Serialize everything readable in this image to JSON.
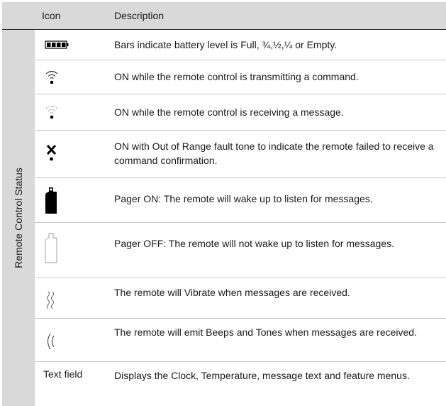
{
  "header": {
    "icon": "Icon",
    "description": "Description"
  },
  "side_label": "Remote Control Status",
  "rows": [
    {
      "icon": "battery-icon",
      "description": "Bars indicate battery level is Full, ¾,½,¼ or Empty."
    },
    {
      "icon": "transmit-icon",
      "description": "ON while the remote control is transmitting a command."
    },
    {
      "icon": "receive-icon",
      "description": "ON while the remote control is receiving a message."
    },
    {
      "icon": "out-of-range-icon",
      "description": "ON with Out of Range fault tone to indicate the remote failed  to receive a command confirmation."
    },
    {
      "icon": "pager-on-icon",
      "description": "Pager ON: The remote will wake up to listen for messages."
    },
    {
      "icon": "pager-off-icon",
      "description": "Pager OFF: The remote will not wake up to listen for messages."
    },
    {
      "icon": "vibrate-icon",
      "description": "The remote will Vibrate when messages are received."
    },
    {
      "icon": "beep-icon",
      "description": "The remote will emit Beeps and Tones when messages are received."
    },
    {
      "icon_text": "Text field",
      "description": "Displays the Clock, Temperature, message text and feature menus."
    }
  ]
}
